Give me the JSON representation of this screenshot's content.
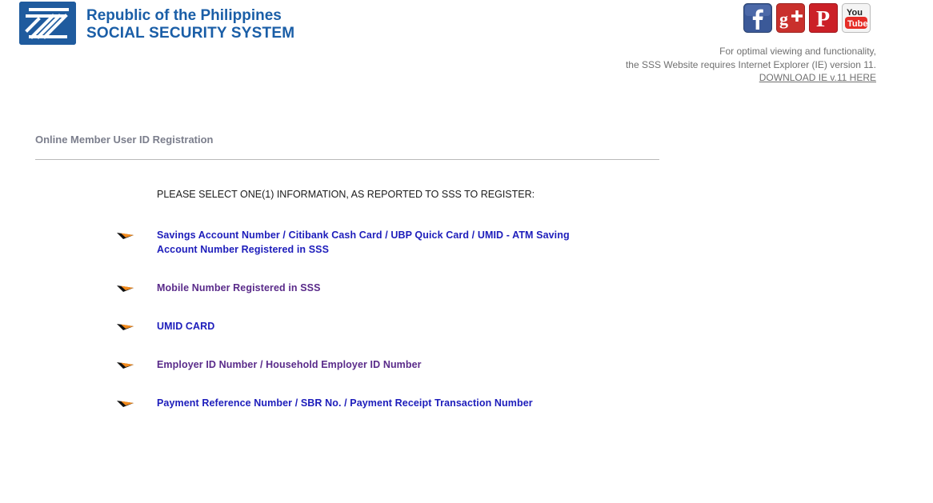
{
  "header": {
    "org_line1": "Republic of the Philippines",
    "org_line2": "SOCIAL SECURITY SYSTEM",
    "logo_icon": "sss-logo-icon",
    "brand_color": "#1a5ea7",
    "social": [
      {
        "name": "facebook-icon",
        "label": "f",
        "color": "#3b5998"
      },
      {
        "name": "google-plus-icon",
        "label": "g+",
        "color": "#d23f31"
      },
      {
        "name": "pinterest-icon",
        "label": "P",
        "color": "#cb2027"
      },
      {
        "name": "youtube-icon",
        "label": "You Tube",
        "color": "#e52d27"
      }
    ],
    "ie_note_line1": "For optimal viewing and functionality,",
    "ie_note_line2": "the SSS Website requires Internet Explorer (IE) version 11.",
    "ie_download_link": "DOWNLOAD IE v.11 HERE"
  },
  "main": {
    "title": "Online Member User ID Registration",
    "instruction": "PLEASE SELECT ONE(1) INFORMATION, AS REPORTED TO SSS TO REGISTER:",
    "options": [
      {
        "label": "Savings Account Number / Citibank Cash Card / UBP Quick Card / UMID - ATM Saving Account Number Registered in SSS",
        "color": "#1d1dbb"
      },
      {
        "label": "Mobile Number Registered in SSS",
        "color": "#5a2b8a"
      },
      {
        "label": "UMID CARD",
        "color": "#1d1dbb"
      },
      {
        "label": "Employer ID Number / Household Employer ID Number",
        "color": "#5a2b8a"
      },
      {
        "label": "Payment Reference Number / SBR No. / Payment Receipt Transaction Number",
        "color": "#1d1dbb"
      }
    ],
    "bullet_icon": "orange-arrow-icon"
  }
}
